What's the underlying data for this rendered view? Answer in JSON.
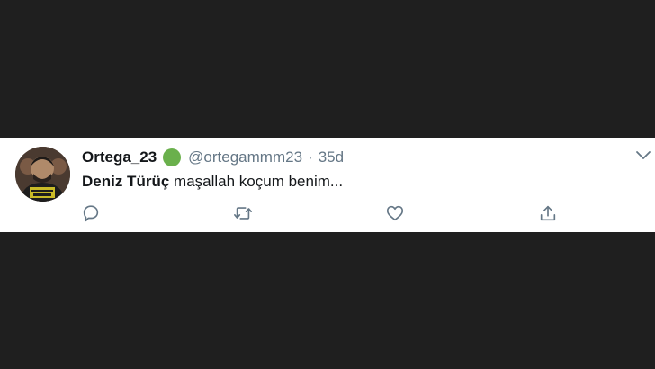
{
  "tweet": {
    "display_name": "Ortega_23",
    "verified_color": "#6ab04c",
    "handle": "@ortegammm23",
    "separator": "·",
    "time": "35d",
    "mention": "Deniz Türüç",
    "text": "maşallah koçum benim..."
  },
  "icons": {
    "avatar": "profile-photo",
    "caret": "chevron-down-icon",
    "reply": "reply-icon",
    "retweet": "retweet-icon",
    "like": "heart-icon",
    "share": "share-icon"
  },
  "colors": {
    "background": "#1f1f1f",
    "card": "#ffffff",
    "text": "#14171a",
    "muted": "#657786"
  }
}
